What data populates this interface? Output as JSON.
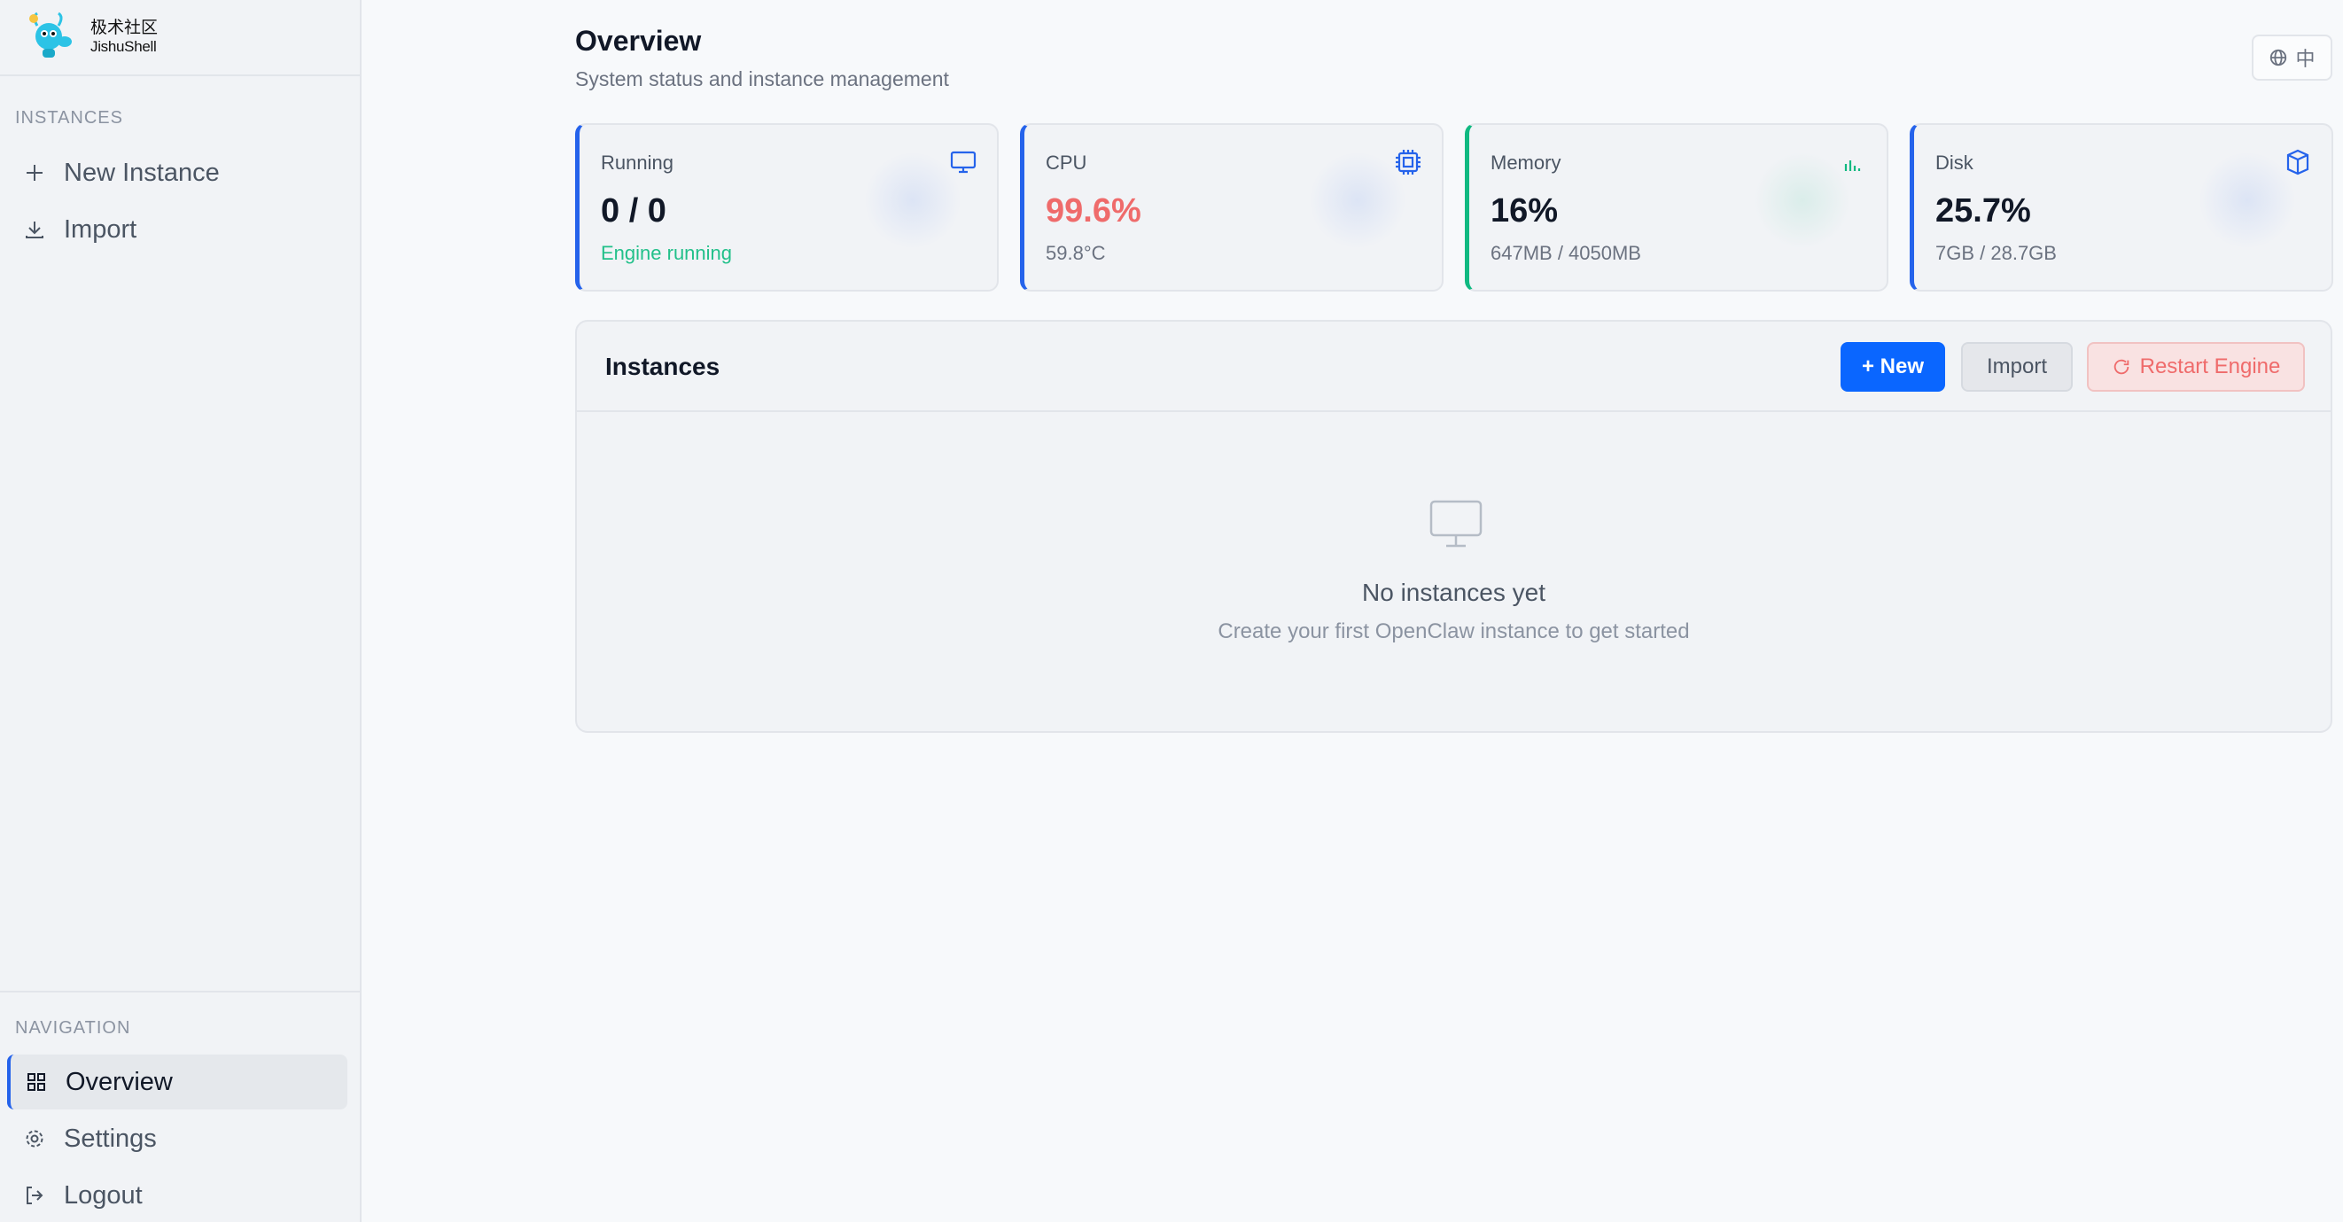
{
  "brand": {
    "name_cn": "极术社区",
    "name_en": "JishuShell"
  },
  "sidebar": {
    "instances_label": "INSTANCES",
    "instances_items": [
      {
        "label": "New Instance",
        "icon": "plus-icon"
      },
      {
        "label": "Import",
        "icon": "download-icon"
      }
    ],
    "navigation_label": "NAVIGATION",
    "nav_items": [
      {
        "label": "Overview",
        "icon": "grid-icon",
        "active": true
      },
      {
        "label": "Settings",
        "icon": "gear-icon"
      },
      {
        "label": "Logout",
        "icon": "logout-icon"
      }
    ]
  },
  "header": {
    "title": "Overview",
    "subtitle": "System status and instance management",
    "language_label": "中"
  },
  "stats": {
    "running": {
      "label": "Running",
      "value": "0 / 0",
      "sub": "Engine running",
      "icon": "monitor-icon"
    },
    "cpu": {
      "label": "CPU",
      "value": "99.6%",
      "sub": "59.8°C",
      "icon": "chip-icon"
    },
    "memory": {
      "label": "Memory",
      "value": "16%",
      "sub": "647MB / 4050MB",
      "icon": "bars-icon"
    },
    "disk": {
      "label": "Disk",
      "value": "25.7%",
      "sub": "7GB / 28.7GB",
      "icon": "database-icon"
    }
  },
  "instances": {
    "title": "Instances",
    "new_button": "+ New",
    "import_button": "Import",
    "restart_button": "Restart Engine",
    "empty_title": "No instances yet",
    "empty_subtitle": "Create your first OpenClaw instance to get started"
  },
  "colors": {
    "accent": "#0a66ff",
    "success": "#22c08a",
    "danger": "#ef6b6b"
  }
}
